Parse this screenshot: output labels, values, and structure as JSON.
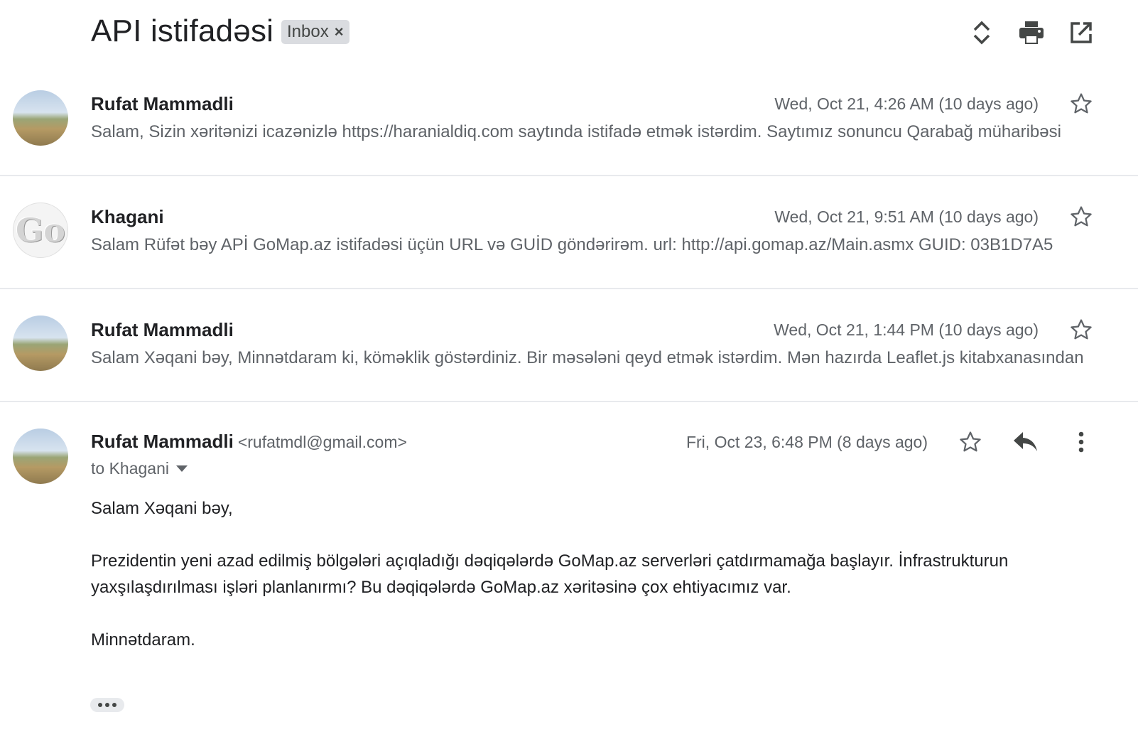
{
  "thread": {
    "subject": "API istifadəsi",
    "label": "Inbox",
    "label_remove_icon": "close-icon",
    "toolbar_icons": [
      "expand-collapse-icon",
      "print-icon",
      "open-in-new-window-icon"
    ]
  },
  "messages": [
    {
      "sender": "Rufat Mammadli",
      "date": "Wed, Oct 21, 4:26 AM (10 days ago)",
      "snippet": "Salam, Sizin xəritənizi icazənizlə https://haranialdiq.com saytında istifadə etmək istərdim. Saytımız sonuncu Qarabağ müharibəsi",
      "avatar": "landscape-photo-avatar"
    },
    {
      "sender": "Khagani",
      "date": "Wed, Oct 21, 9:51 AM (10 days ago)",
      "snippet": "Salam Rüfət bəy APİ GoMap.az istifadəsi üçün URL və GUİD göndərirəm. url: http://api.gomap.az/Main.asmx GUID: 03B1D7A5",
      "avatar": "gomap-logo-avatar",
      "avatar_text": "Go"
    },
    {
      "sender": "Rufat Mammadli",
      "date": "Wed, Oct 21, 1:44 PM (10 days ago)",
      "snippet": "Salam Xəqani bəy, Minnətdaram ki, köməklik göstərdiniz. Bir məsələni qeyd etmək istərdim. Mən hazırda Leaflet.js kitabxanasından",
      "avatar": "landscape-photo-avatar"
    }
  ],
  "open_message": {
    "sender": "Rufat Mammadli",
    "email": "<rufatmdl@gmail.com>",
    "date": "Fri, Oct 23, 6:48 PM (8 days ago)",
    "to": "to Khagani",
    "body": {
      "greeting": "Salam Xəqani bəy,",
      "paragraph": "Prezidentin yeni azad edilmiş bölgələri açıqladığı dəqiqələrdə GoMap.az serverləri çatdırmamağa başlayır. İnfrastrukturun yaxşılaşdırılması işləri planlanırmı? Bu dəqiqələrdə GoMap.az xəritəsinə çox ehtiyacımız var.",
      "closing": "Minnətdaram."
    },
    "icons": [
      "star-icon",
      "reply-icon",
      "more-vert-icon"
    ]
  }
}
